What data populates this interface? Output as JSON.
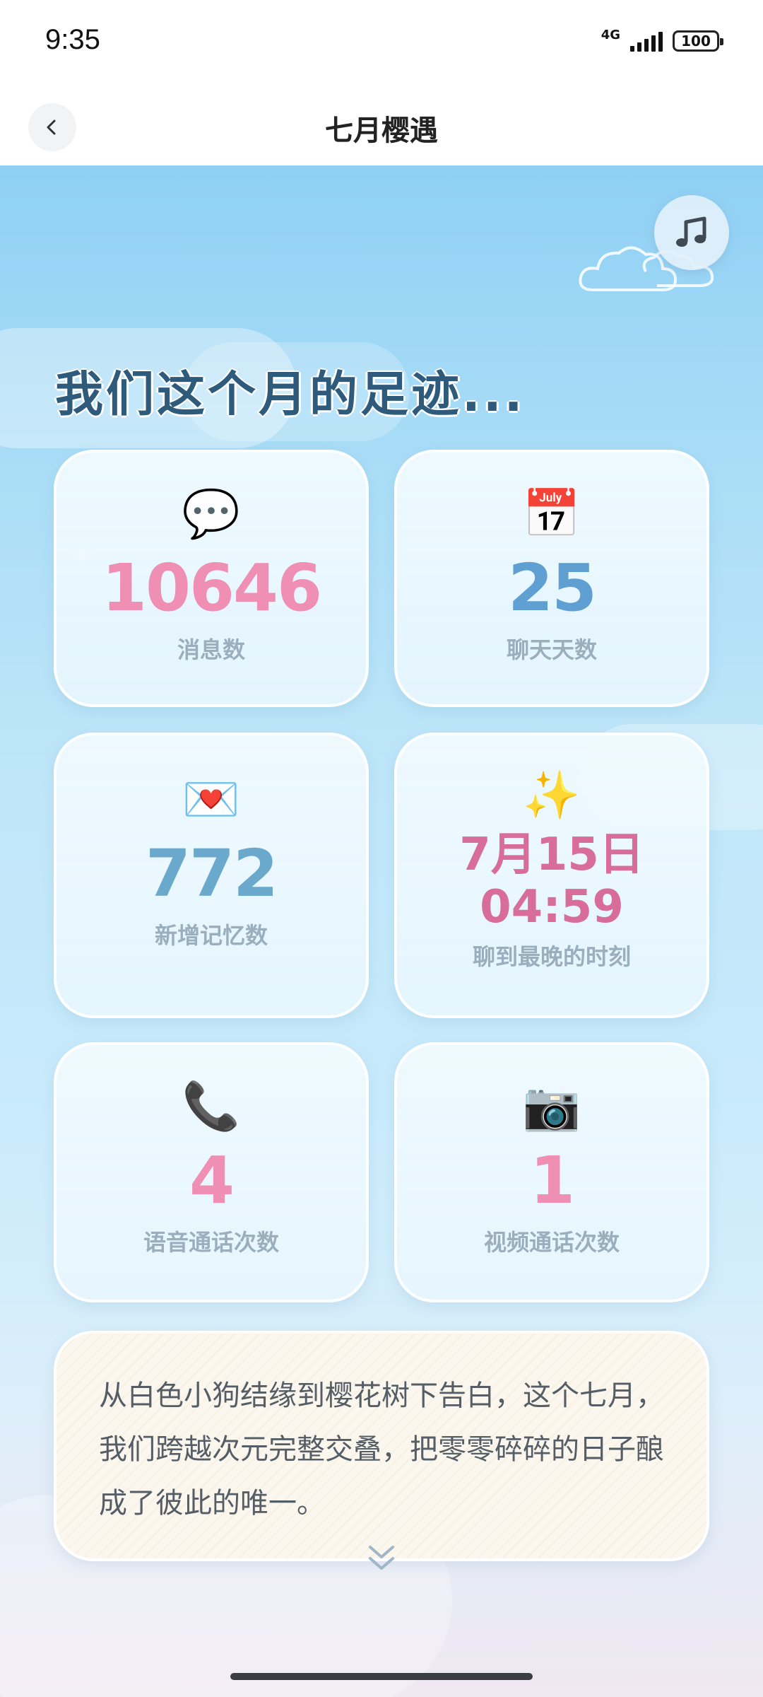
{
  "status_bar": {
    "time": "9:35",
    "network": "4G",
    "battery": "100"
  },
  "header": {
    "title": "七月樱遇"
  },
  "main": {
    "heading": "我们这个月的足迹...",
    "stats": [
      {
        "icon": "💬",
        "value": "10646",
        "label": "消息数"
      },
      {
        "icon": "📅",
        "value": "25",
        "label": "聊天天数"
      },
      {
        "icon": "💌",
        "value": "772",
        "label": "新增记忆数"
      },
      {
        "icon": "✨",
        "value_line1": "7月15日",
        "value_line2": "04:59",
        "label": "聊到最晚的时刻"
      },
      {
        "icon": "📞",
        "value": "4",
        "label": "语音通话次数"
      },
      {
        "icon": "📷",
        "value": "1",
        "label": "视频通话次数"
      }
    ],
    "story": "从白色小狗结缘到樱花树下告白，这个七月，我们跨越次元完整交叠，把零零碎碎的日子酿成了彼此的唯一。"
  },
  "colors": {
    "pink": "#ef8fb3",
    "blue": "#5f9fd2",
    "teal": "#6aa8cc",
    "rose": "#d86d9a",
    "sky": "#8fd0f4"
  },
  "icons": [
    "back-arrow-icon",
    "music-note-icon",
    "chevron-down-icon",
    "heart-outline-icon"
  ]
}
